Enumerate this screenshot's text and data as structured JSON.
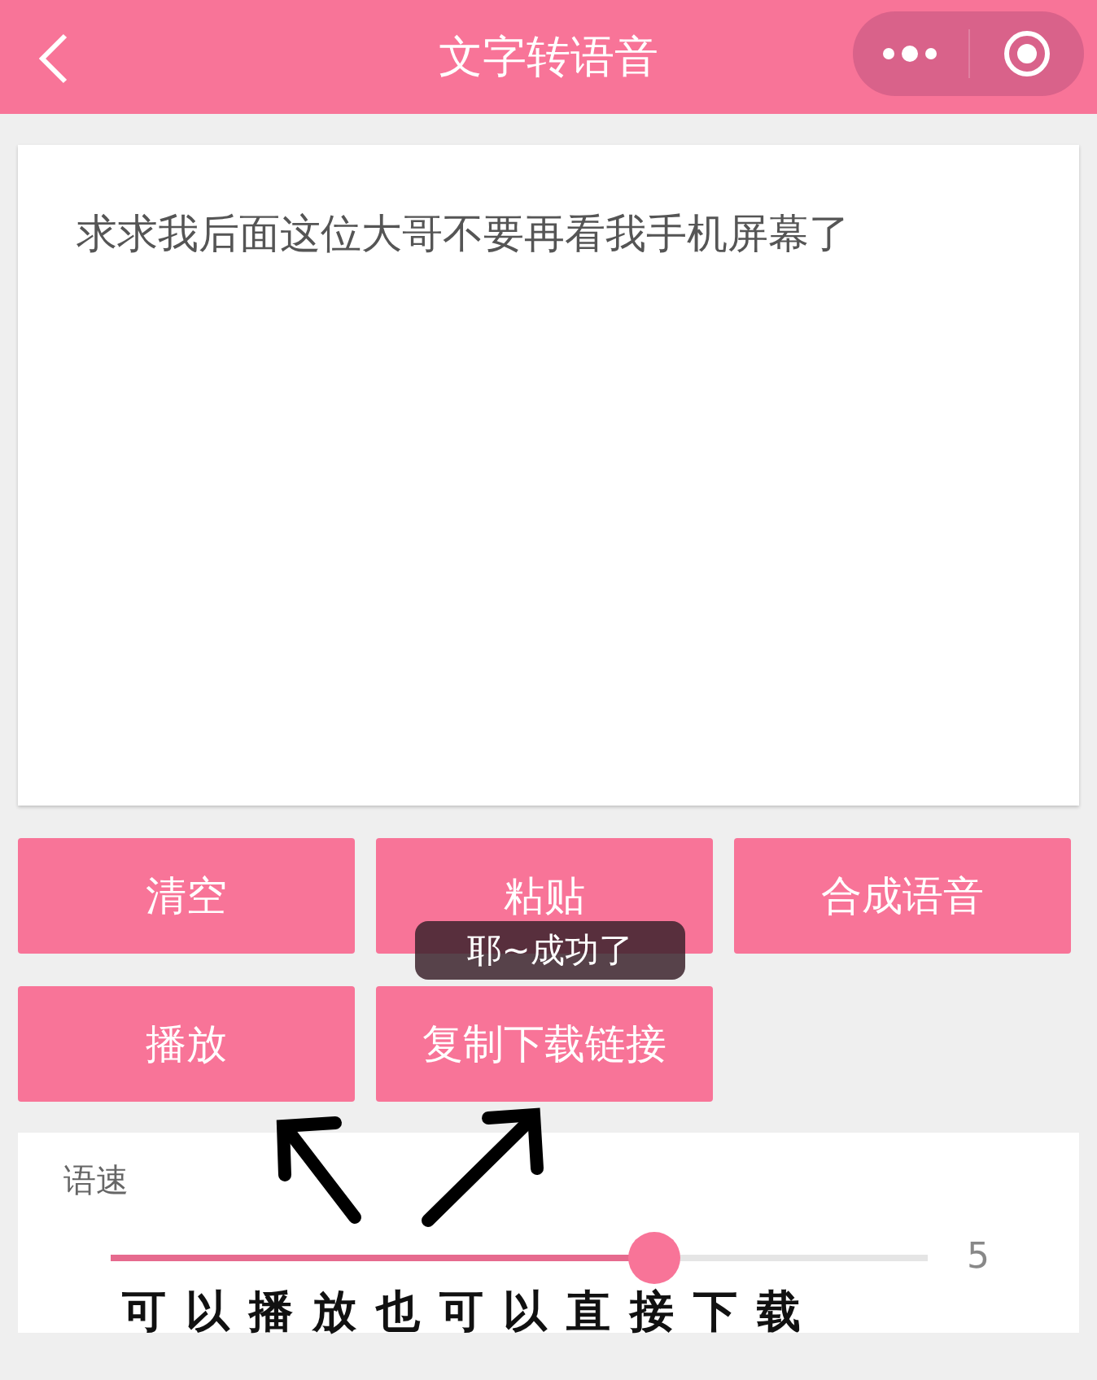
{
  "nav_bar": {
    "title": "文字转语音"
  },
  "text_input": {
    "value": "求求我后面这位大哥不要再看我手机屏幕了"
  },
  "buttons": [
    {
      "label": "清空"
    },
    {
      "label": "粘贴"
    },
    {
      "label": "合成语音"
    },
    {
      "label": "播放"
    },
    {
      "label": "复制下载链接"
    }
  ],
  "toast": {
    "text": "耶~成功了"
  },
  "speed": {
    "label": "语速",
    "level": 0.665,
    "reading": "5"
  },
  "annotation": {
    "text": "可以播放也可以直接下载"
  }
}
